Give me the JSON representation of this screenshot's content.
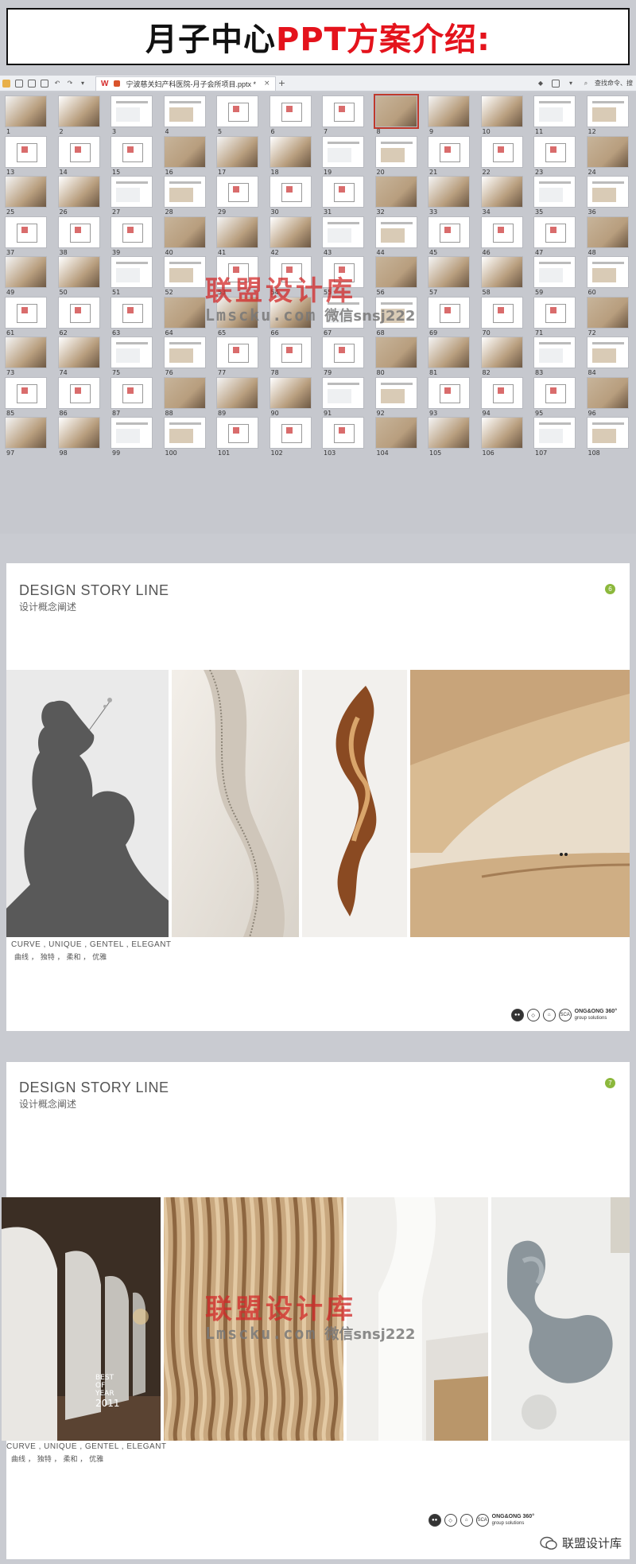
{
  "header": {
    "title_part1": "月子中心",
    "title_part2": "PPT方案介绍:"
  },
  "toolbar": {
    "tab_title": "宁波慈关妇产科医院-月子会所项目.pptx *",
    "add_tab": "+",
    "search_label": "查找命令、搜"
  },
  "thumbnails": {
    "selected": 8,
    "numbers": [
      "1",
      "2",
      "3",
      "4",
      "5",
      "6",
      "7",
      "8",
      "9",
      "10",
      "11",
      "12",
      "13",
      "14",
      "15",
      "16",
      "17",
      "18",
      "19",
      "20",
      "21",
      "22",
      "23",
      "24",
      "25",
      "26",
      "27",
      "28",
      "29",
      "30",
      "31",
      "32",
      "33",
      "34",
      "35",
      "36",
      "37",
      "38",
      "39",
      "40",
      "41",
      "42",
      "43",
      "44",
      "45",
      "46",
      "47",
      "48",
      "49",
      "50",
      "51",
      "52",
      "53",
      "54",
      "55",
      "56",
      "57",
      "58",
      "59",
      "60",
      "61",
      "62",
      "63",
      "64",
      "65",
      "66",
      "67",
      "68",
      "69",
      "70",
      "71",
      "72",
      "73",
      "74",
      "75",
      "76",
      "77",
      "78",
      "79",
      "80",
      "81",
      "82",
      "83",
      "84",
      "85",
      "86",
      "87",
      "88",
      "89",
      "90",
      "91",
      "92",
      "93",
      "94",
      "95",
      "96",
      "97",
      "98",
      "99",
      "100",
      "101",
      "102",
      "103",
      "104",
      "105",
      "106",
      "107",
      "108"
    ]
  },
  "watermark": {
    "cn": "联盟设计库",
    "en": "Lmscku.com",
    "wechat": "微信snsj222"
  },
  "slides": [
    {
      "title": "DESIGN STORY LINE",
      "subtitle": "设计概念阐述",
      "page": "6",
      "caption_en": "CURVE , UNIQUE , GENTEL , ELEGANT",
      "caption_cn": "曲线    ，   独特   ，  柔和    ，  优雅",
      "brand": "ONG&ONG 360°",
      "brand_sub": "group solutions",
      "sca": "SCA"
    },
    {
      "title": "DESIGN STORY LINE",
      "subtitle": "设计概念阐述",
      "page": "7",
      "caption_en": "CURVE , UNIQUE , GENTEL , ELEGANT",
      "caption_cn": "曲线    ，   独特   ，  柔和    ，  优雅",
      "brand": "ONG&ONG 360°",
      "brand_sub": "group solutions",
      "sca": "SCA",
      "award_line1": "BEST",
      "award_line2": "OF",
      "award_line3": "YEAR",
      "award_year": "2011"
    }
  ],
  "footer": {
    "wechat_account": "联盟设计库"
  },
  "colors": {
    "title_red": "#e4131c",
    "page_badge": "#8cb83c",
    "watermark_red": "#d22828"
  }
}
